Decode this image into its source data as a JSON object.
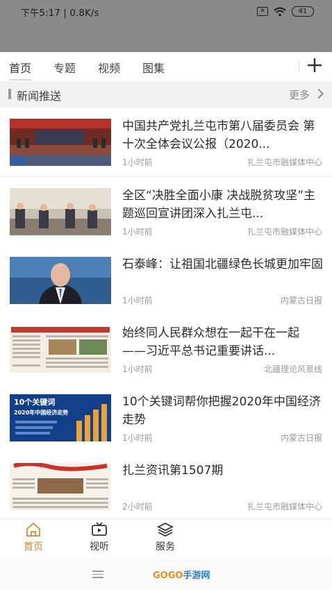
{
  "status_bar": {
    "time_speed": "下午5:17 | 0.8K/s",
    "battery": "41"
  },
  "tabs": [
    "首页",
    "专题",
    "视频",
    "图集"
  ],
  "section": {
    "title": "新闻推送",
    "more": "更多"
  },
  "news": [
    {
      "title": "中国共产党扎兰屯市第八届委员会 第十次全体会议公报（2020...",
      "time": "1小时前",
      "source": "扎兰屯市融媒体中心",
      "thumb": "meeting-stage-photo"
    },
    {
      "title": "全区“决胜全面小康 决战脱贫攻坚”主题巡回宣讲团深入扎兰屯...",
      "time": "1小时前",
      "source": "扎兰屯市融媒体中心",
      "thumb": "lecture-room-photo"
    },
    {
      "title": "石泰峰：让祖国北疆绿色长城更加牢固",
      "time": "1小时前",
      "source": "内蒙古日报",
      "thumb": "portrait-photo"
    },
    {
      "title": "始终同人民群众想在一起干在一起 ——习近平总书记重要讲话...",
      "time": "1小时前",
      "source": "北疆理论风景线",
      "thumb": "newspaper-page"
    },
    {
      "title": "10个关键词帮你把握2020年中国经济走势",
      "time": "1小时前",
      "source": "内蒙古日报",
      "thumb": "economy-infographic",
      "thumb_text": {
        "line1": "10个关键词",
        "line2": "2020年中国经济走势"
      }
    },
    {
      "title": "扎兰资讯第1507期",
      "time": "2小时前",
      "source": "扎兰屯市融媒体中心",
      "thumb": "newspaper-front"
    }
  ],
  "bottom_nav": [
    {
      "label": "首页",
      "icon": "home-icon",
      "active": true
    },
    {
      "label": "视听",
      "icon": "tv-icon",
      "active": false
    },
    {
      "label": "服务",
      "icon": "layers-icon",
      "active": false
    }
  ],
  "watermark": {
    "go": "GOGO",
    "rest": "手游网"
  },
  "colors": {
    "accent": "#c98a32",
    "status_bar": "#8a8a8a",
    "section_bg": "#f2f2f2"
  }
}
